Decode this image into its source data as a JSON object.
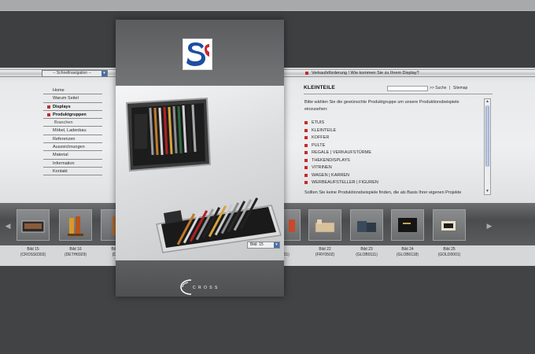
{
  "header": {
    "quicknav_label": "-- Schnellnavigation --",
    "promo_text": "Verkaufsförderung ! Wie kommen Sie zu Ihrem Display?"
  },
  "nav": {
    "items": [
      {
        "label": "Home",
        "active": false
      },
      {
        "label": "Warum Seitel",
        "active": false
      },
      {
        "label": "Displays",
        "active": true
      },
      {
        "label": "Produktgruppen",
        "active": true
      },
      {
        "label": "Branchen",
        "active": false
      },
      {
        "label": "Möbel, Ladenbau",
        "active": false
      },
      {
        "label": "Referenzen",
        "active": false
      },
      {
        "label": "Auszeichnungen",
        "active": false
      },
      {
        "label": "Material",
        "active": false
      },
      {
        "label": "Information",
        "active": false
      },
      {
        "label": "Kontakt",
        "active": false
      }
    ]
  },
  "panel": {
    "bild_select": "Bild: 15",
    "brand_text": "C R O S S"
  },
  "content": {
    "title": "KLEINTEILE",
    "search_label": ">> Suche",
    "separator": "|",
    "sitemap_label": "Sitemap",
    "intro": "Bitte wählen Sie die gewünschte Produktgruppe um unsere Produktionsbeispiele einzusehen:",
    "categories": [
      "ETUIS",
      "KLEINTEILE",
      "KOFFER",
      "PULTE",
      "REGALE | VERKAUFSTÜRME",
      "THEKENDISPLAYS",
      "VITRINEN",
      "WAGEN | KARREN",
      "WERBEAUFSTELLER | FIGUREN"
    ],
    "outro": "Sollten Sie keine Produktionsbeispiele finden, die als Basis Ihrer eigenen Projekte"
  },
  "thumbnails": [
    {
      "caption_line1": "Bild 15",
      "caption_line2": "(CROSS0303)"
    },
    {
      "caption_line1": "Bild 16",
      "caption_line2": "(DETH6929)"
    },
    {
      "caption_line1": "Bild 17",
      "caption_line2": "(DOU"
    },
    {
      "caption_line1": "21",
      "caption_line2": "0201)"
    },
    {
      "caption_line1": "Bild 22",
      "caption_line2": "(FRY0502)"
    },
    {
      "caption_line1": "Bild 23",
      "caption_line2": "(GLOB0111)"
    },
    {
      "caption_line1": "Bild 24",
      "caption_line2": "(GLOB0118)"
    },
    {
      "caption_line1": "Bild 25",
      "caption_line2": "(GOLD0001)"
    }
  ],
  "arrows": {
    "left": "◀",
    "right": "▶"
  },
  "scrollbar": {
    "up": "▲",
    "down": "▼"
  },
  "colors": {
    "accent_red": "#c62a2a",
    "logo_blue": "#1d4fa0",
    "logo_red": "#c8262e"
  }
}
